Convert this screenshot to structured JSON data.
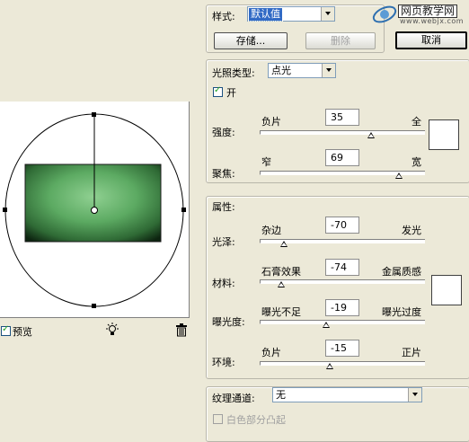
{
  "style_row": {
    "label": "样式:",
    "value": "默认值",
    "save_label": "存储...",
    "delete_label": "删除"
  },
  "actions": {
    "cancel_label": "取消"
  },
  "watermark": {
    "title": "网页教学网",
    "url": "www.webjx.com"
  },
  "light_type": {
    "label": "光照类型:",
    "value": "点光",
    "on_label": "开",
    "on_checked": true
  },
  "light_sliders": [
    {
      "label": "强度:",
      "left": "负片",
      "right": "全",
      "value": "35",
      "position": 0.675
    },
    {
      "label": "聚焦:",
      "left": "窄",
      "right": "宽",
      "value": "69",
      "position": 0.845
    }
  ],
  "properties": {
    "title": "属性:",
    "sliders": [
      {
        "label": "光泽:",
        "left": "杂边",
        "right": "发光",
        "value": "-70",
        "position": 0.15
      },
      {
        "label": "材料:",
        "left": "石膏效果",
        "right": "金属质感",
        "value": "-74",
        "position": 0.13
      },
      {
        "label": "曝光度:",
        "left": "曝光不足",
        "right": "曝光过度",
        "value": "-19",
        "position": 0.405
      },
      {
        "label": "环境:",
        "left": "负片",
        "right": "正片",
        "value": "-15",
        "position": 0.425
      }
    ]
  },
  "texture": {
    "label": "纹理通道:",
    "value": "无",
    "white_high_label": "白色部分凸起"
  },
  "preview": {
    "label": "预览",
    "checked": true,
    "light_icon": "lightbulb-icon",
    "trash_icon": "trash-icon"
  },
  "colors": {
    "dialog_bg": "#ece9d8",
    "selection": "#316ac5",
    "checkbox_check": "#21a121"
  }
}
